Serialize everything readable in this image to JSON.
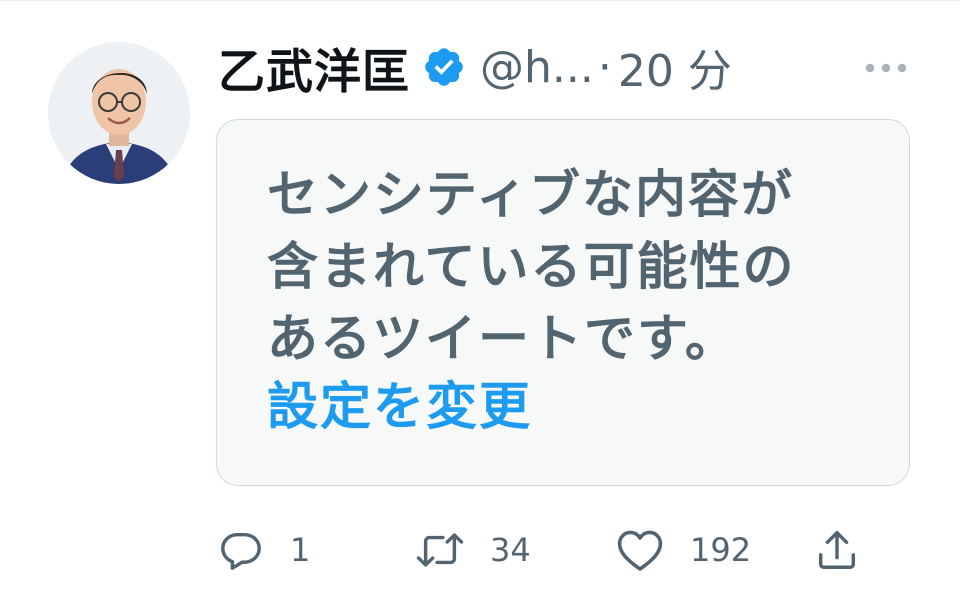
{
  "tweet": {
    "display_name": "乙武洋匡",
    "handle": "@h...",
    "separator": "·",
    "time": "20 分",
    "verified_icon": "verified-badge-icon",
    "more_icon": "more-dots-icon"
  },
  "sensitive": {
    "message_lines": [
      "センシティブな内容が",
      "含まれている可能性の",
      "あるツイートです。"
    ],
    "settings_link": "設定を変更"
  },
  "actions": {
    "reply": {
      "icon": "reply-icon",
      "count": "1"
    },
    "retweet": {
      "icon": "retweet-icon",
      "count": "34"
    },
    "like": {
      "icon": "heart-icon",
      "count": "192"
    },
    "share": {
      "icon": "share-icon"
    }
  },
  "colors": {
    "accent": "#1d9bf0",
    "secondary_text": "#536471",
    "primary_text": "#0f1419",
    "box_background": "#f7f9f9",
    "box_border": "#cfd9de"
  }
}
